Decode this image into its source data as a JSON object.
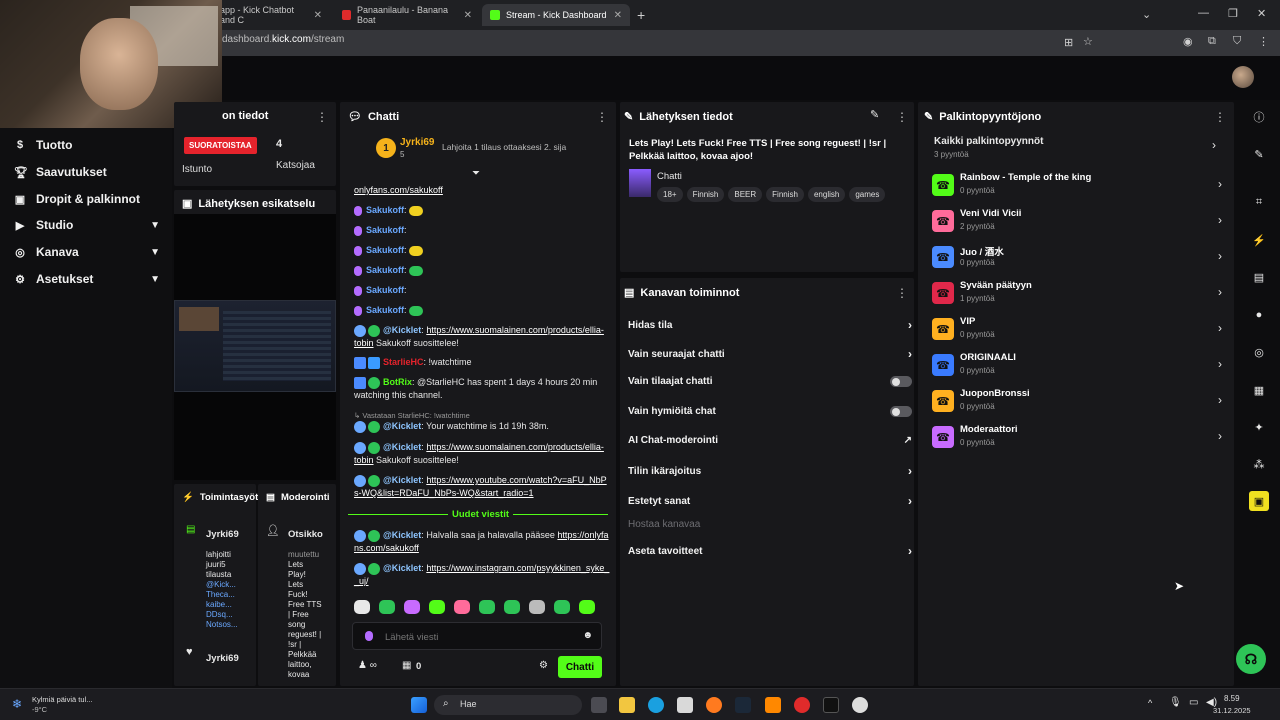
{
  "browser": {
    "tabs": [
      {
        "label": "app - Kick Chatbot and C",
        "active": false
      },
      {
        "label": "Panaanilaulu - Banana Boat",
        "active": false
      },
      {
        "label": "Stream - Kick Dashboard",
        "active": true
      }
    ],
    "url_host": "dashboard.",
    "url_domain": "kick.com",
    "url_path": "/stream"
  },
  "sidebar": {
    "items": [
      {
        "label": "Tuotto",
        "icon": "dollar-icon"
      },
      {
        "label": "Saavutukset",
        "icon": "trophy-icon"
      },
      {
        "label": "Dropit & palkinnot",
        "icon": "gift-icon"
      },
      {
        "label": "Studio",
        "icon": "video-icon",
        "expandable": true
      },
      {
        "label": "Kanava",
        "icon": "broadcast-icon",
        "expandable": true
      },
      {
        "label": "Asetukset",
        "icon": "gear-icon",
        "expandable": true
      }
    ]
  },
  "stats": {
    "title": "on tiedot",
    "live_label": "SUORATOISTAA",
    "session_label": "Istunto",
    "viewers_value": "4",
    "viewers_label": "Katsojaa"
  },
  "preview": {
    "title": "Lähetyksen esikatselu"
  },
  "activity": {
    "title": "Toimintasyöt",
    "user": "Jyrki69",
    "lines": [
      "lahjoitti",
      "juuri5",
      "tilausta",
      "@Kick...",
      "Theca...",
      "kaibe...",
      "DDsq...",
      "Notsos..."
    ],
    "user2": "Jyrki69"
  },
  "mods": {
    "title": "Moderointi",
    "user": "Otsikko",
    "lines": [
      "muutettu",
      "Lets",
      "Play!",
      "Lets",
      "Fuck!",
      "Free TTS",
      "| Free",
      "song",
      "reguest! |",
      "!sr |",
      "Pelkkää",
      "laittoo,",
      "kovaa"
    ]
  },
  "chat": {
    "title": "Chatti",
    "pinned_user": "Jyrki69",
    "pinned_sub": "5",
    "pinned_note": "Lahjoita 1 tilaus ottaaksesi 2. sija",
    "top_link": "onlyfans.com/sakukoff",
    "user_saku": "Sakukoff",
    "l1_user": "@Kicklet",
    "l1_link": "https://www.suomalainen.com/products/ellia-tobin",
    "l1_tail": "Sakukoff suosittelee!",
    "l2_user": "StarlieHC",
    "l2_text": "!watchtime",
    "l3_user": "BotRix",
    "l3_text": "@StarlieHC has spent 1 days 4 hours 20 min watching this channel.",
    "reply_note": "Vastataan StarlieHC: !watchtime",
    "l4_user": "@Kicklet",
    "l4_text": "Your watchtime is 1d 19h 38m.",
    "l5_user": "@Kicklet",
    "l5_link": "https://www.suomalainen.com/products/ellia-tobin",
    "l5_tail": "Sakukoff suosittelee!",
    "l6_user": "@Kicklet",
    "l6_link": "https://www.youtube.com/watch?v=aFU_NbPs-WQ&list=RDaFU_NbPs-WQ&start_radio=1",
    "new_messages": "Uudet viestit",
    "l7_user": "@Kicklet",
    "l7_text": "Halvalla saa ja halavalla pääsee",
    "l7_link": "https://onlyfans.com/sakukoff",
    "l8_user": "@Kicklet",
    "l8_link": "https://www.instagram.com/psyykkinen_syke__uj/",
    "input_placeholder": "Lähetä viesti",
    "points_count": "0",
    "send_label": "Chatti"
  },
  "stream_info": {
    "title": "Lähetyksen tiedot",
    "stream_title": "Lets Play! Lets Fuck! Free TTS | Free song reguest! | !sr | Pelkkää laittoo, kovaa ajoo!",
    "category": "Chatti",
    "tags": [
      "18+",
      "Finnish",
      "BEER",
      "Finnish",
      "english",
      "games"
    ]
  },
  "channel_actions": {
    "title": "Kanavan toiminnot",
    "items": [
      {
        "label": "Hidas tila",
        "type": "chevron"
      },
      {
        "label": "Vain seuraajat chatti",
        "type": "chevron"
      },
      {
        "label": "Vain tilaajat chatti",
        "type": "toggle"
      },
      {
        "label": "Vain hymiöitä chat",
        "type": "toggle"
      },
      {
        "label": "AI Chat-moderointi",
        "type": "external"
      },
      {
        "label": "Tilin ikärajoitus",
        "type": "chevron"
      },
      {
        "label": "Estetyt sanat",
        "type": "chevron"
      },
      {
        "label": "Hostaa kanavaa",
        "type": "disabled"
      },
      {
        "label": "Aseta tavoitteet",
        "type": "chevron"
      }
    ]
  },
  "rewards": {
    "title": "Palkintopyyntöjono",
    "all_label": "Kaikki palkintopyynnöt",
    "all_count": "3 pyyntöä",
    "items": [
      {
        "title": "Rainbow - Temple of the king",
        "count": "0 pyyntöä",
        "color": "#53fc18"
      },
      {
        "title": "Veni Vidi Vicii",
        "count": "2 pyyntöä",
        "color": "#ff6b9a"
      },
      {
        "title": "Juo / 酒水",
        "count": "0 pyyntöä",
        "color": "#4b8bff"
      },
      {
        "title": "Syvään päätyyn",
        "count": "1 pyyntöä",
        "color": "#e0284a"
      },
      {
        "title": "VIP",
        "count": "0 pyyntöä",
        "color": "#ffb020"
      },
      {
        "title": "ORIGINAALI",
        "count": "0 pyyntöä",
        "color": "#3a7bff"
      },
      {
        "title": "JuoponBronssi",
        "count": "0 pyyntöä",
        "color": "#ffb020"
      },
      {
        "title": "Moderaattori",
        "count": "0 pyyntöä",
        "color": "#c86bff"
      }
    ]
  },
  "taskbar": {
    "weather_title": "Kylmiä päiviä tul...",
    "weather_temp": "-9°C",
    "search_label": "Hae",
    "time": "8.59",
    "date": "31.12.2025"
  },
  "colors": {
    "accent": "#53fc18",
    "live": "#e5232c"
  }
}
